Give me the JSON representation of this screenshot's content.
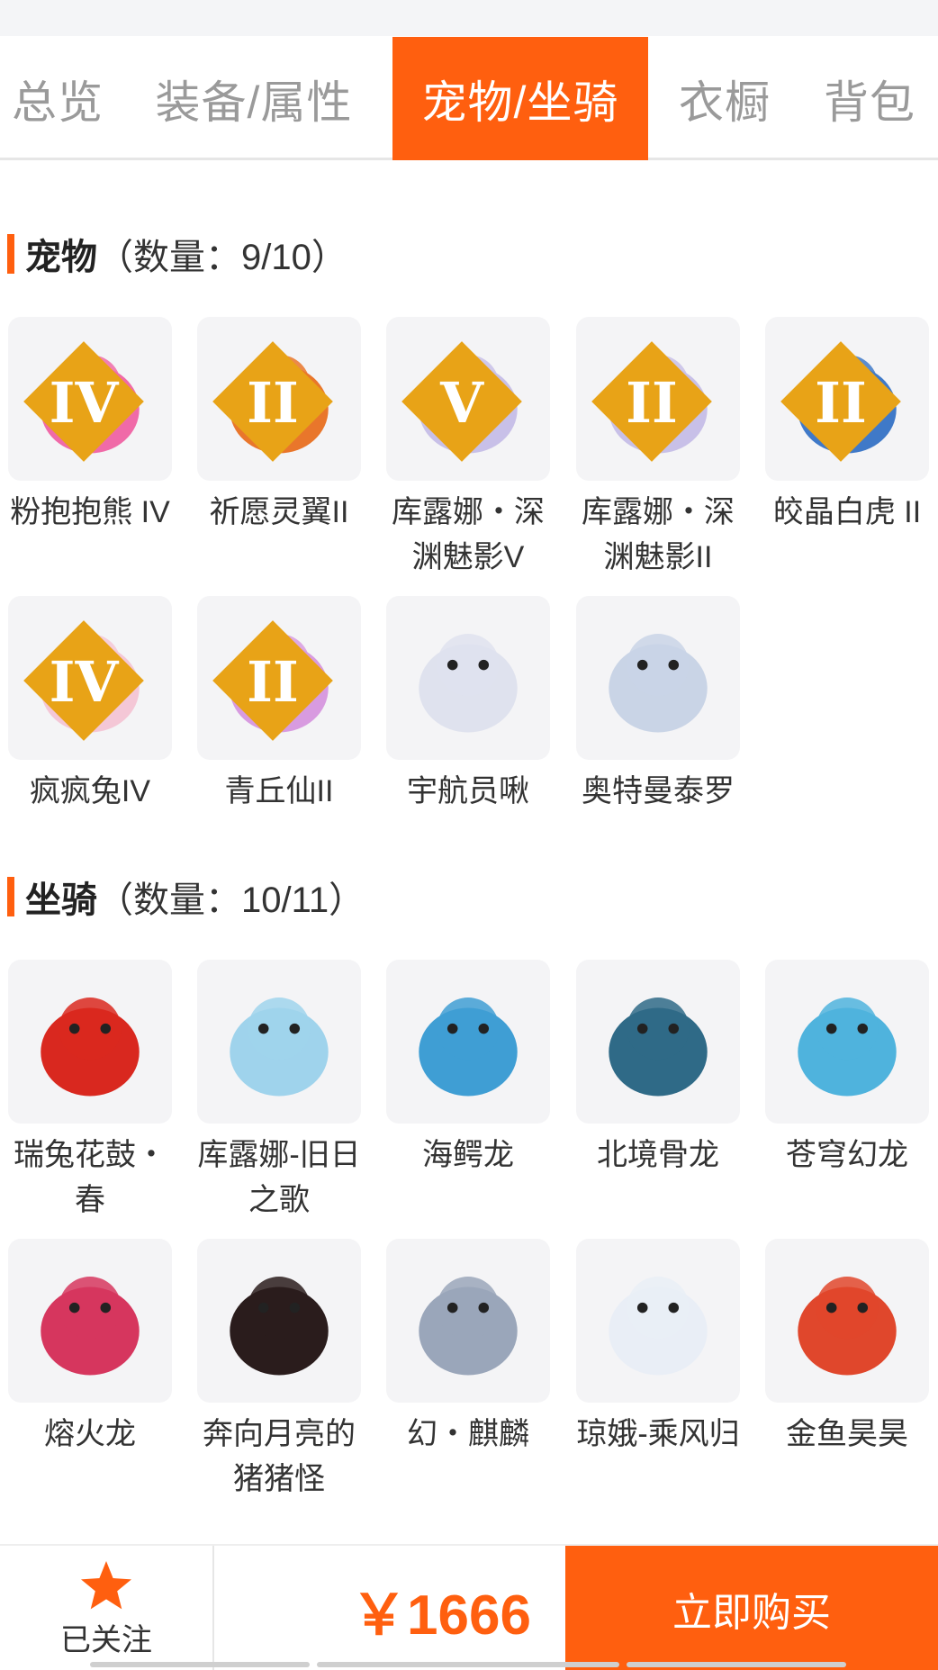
{
  "tabs": [
    {
      "label": "总览",
      "active": false
    },
    {
      "label": "装备/属性",
      "active": false
    },
    {
      "label": "宠物/坐骑",
      "active": true
    },
    {
      "label": "衣橱",
      "active": false
    },
    {
      "label": "背包",
      "active": false
    }
  ],
  "pets": {
    "title": "宠物",
    "count": "（数量：9/10）",
    "items": [
      {
        "name": "粉抱抱熊 IV",
        "rank": "IV",
        "icon": "pink-bear-icon",
        "color": "#f06aa8"
      },
      {
        "name": "祈愿灵翼II",
        "rank": "II",
        "icon": "griffin-icon",
        "color": "#e9762b"
      },
      {
        "name": "库露娜・深渊魅影V",
        "rank": "V",
        "icon": "kuluna-spirit-icon",
        "color": "#c8c0e8"
      },
      {
        "name": "库露娜・深渊魅影II",
        "rank": "II",
        "icon": "kuluna-spirit-icon",
        "color": "#c8c0e8"
      },
      {
        "name": "皎晶白虎 II",
        "rank": "II",
        "icon": "white-tiger-icon",
        "color": "#3f79c8"
      },
      {
        "name": "疯疯兔IV",
        "rank": "IV",
        "icon": "rabbit-icon",
        "color": "#f4c7d6"
      },
      {
        "name": "青丘仙II",
        "rank": "II",
        "icon": "fox-fairy-icon",
        "color": "#d89be0"
      },
      {
        "name": "宇航员啾",
        "rank": "",
        "icon": "astronaut-icon",
        "color": "#dfe2ee"
      },
      {
        "name": "奥特曼泰罗",
        "rank": "",
        "icon": "ultraman-icon",
        "color": "#c9d4e6"
      }
    ]
  },
  "mounts": {
    "title": "坐骑",
    "count": "（数量：10/11）",
    "items": [
      {
        "name": "瑞兔花鼓・春",
        "icon": "drum-icon",
        "color": "#d9281f"
      },
      {
        "name": "库露娜-旧日之歌",
        "icon": "sheep-girl-icon",
        "color": "#9fd3ec"
      },
      {
        "name": "海鳄龙",
        "icon": "sea-dragon-icon",
        "color": "#3f9ed4"
      },
      {
        "name": "北境骨龙",
        "icon": "bone-dragon-icon",
        "color": "#2f6a87"
      },
      {
        "name": "苍穹幻龙",
        "icon": "sky-dragon-icon",
        "color": "#4fb3dd"
      },
      {
        "name": "熔火龙",
        "icon": "fire-dragon-icon",
        "color": "#d6365e"
      },
      {
        "name": "奔向月亮的猪猪怪",
        "icon": "pig-icon",
        "color": "#2a1c1c"
      },
      {
        "name": "幻・麒麟",
        "icon": "qilin-icon",
        "color": "#9aa6ba"
      },
      {
        "name": "琼娥-乘风归",
        "icon": "moon-fairy-icon",
        "color": "#e9eef6"
      },
      {
        "name": "金鱼昊昊",
        "icon": "goldfish-icon",
        "color": "#e0472c"
      }
    ]
  },
  "footer": {
    "follow_label": "已关注",
    "price": "￥1666",
    "buy_label": "立即购买"
  },
  "colors": {
    "accent": "#ff5f0f",
    "badge": "#e8a317"
  }
}
